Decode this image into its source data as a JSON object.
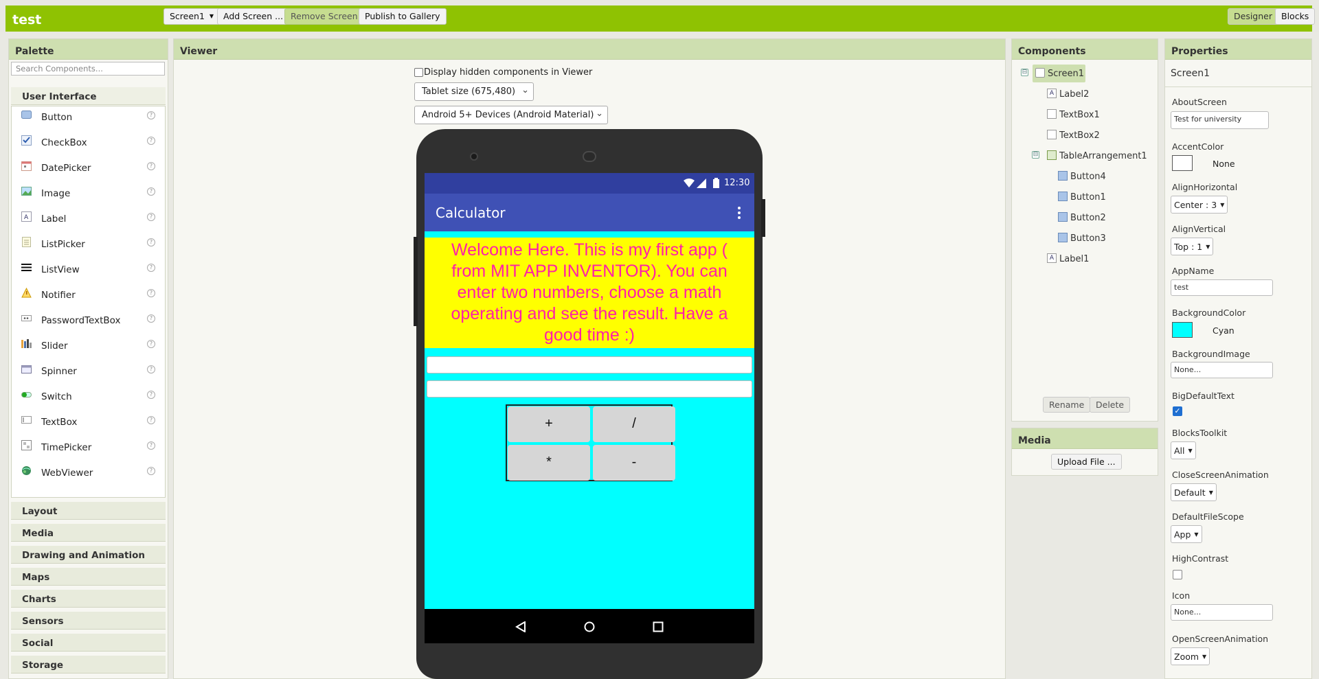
{
  "app": {
    "title": "test"
  },
  "toolbar": {
    "screen_select": "Screen1",
    "add_screen": "Add Screen ...",
    "remove_screen": "Remove Screen",
    "publish": "Publish to Gallery",
    "designer": "Designer",
    "blocks": "Blocks"
  },
  "palette": {
    "title": "Palette",
    "search_placeholder": "Search Components...",
    "open_category": "User Interface",
    "items": [
      {
        "label": "Button",
        "icon": "button-icon"
      },
      {
        "label": "CheckBox",
        "icon": "checkbox-icon"
      },
      {
        "label": "DatePicker",
        "icon": "datepicker-icon"
      },
      {
        "label": "Image",
        "icon": "image-icon"
      },
      {
        "label": "Label",
        "icon": "label-icon"
      },
      {
        "label": "ListPicker",
        "icon": "listpicker-icon"
      },
      {
        "label": "ListView",
        "icon": "listview-icon"
      },
      {
        "label": "Notifier",
        "icon": "notifier-icon"
      },
      {
        "label": "PasswordTextBox",
        "icon": "password-icon"
      },
      {
        "label": "Slider",
        "icon": "slider-icon"
      },
      {
        "label": "Spinner",
        "icon": "spinner-icon"
      },
      {
        "label": "Switch",
        "icon": "switch-icon"
      },
      {
        "label": "TextBox",
        "icon": "textbox-icon"
      },
      {
        "label": "TimePicker",
        "icon": "timepicker-icon"
      },
      {
        "label": "WebViewer",
        "icon": "webviewer-icon"
      }
    ],
    "help_glyph": "?",
    "categories": [
      "Layout",
      "Media",
      "Drawing and Animation",
      "Maps",
      "Charts",
      "Sensors",
      "Social",
      "Storage"
    ]
  },
  "viewer": {
    "title": "Viewer",
    "hidden_label": "Display hidden components in Viewer",
    "size_select": "Tablet size (675,480)",
    "theme_select": "Android 5+ Devices (Android Material)",
    "phone": {
      "time": "12:30",
      "app_title": "Calculator",
      "welcome": "Welcome Here. This is my first app ( from MIT APP INVENTOR). You can enter two numbers, choose a math operating and see the result. Have a good time :)",
      "buttons": [
        "+",
        "/",
        "*",
        "-"
      ]
    }
  },
  "components": {
    "title": "Components",
    "tree": [
      {
        "label": "Screen1",
        "icon": "screen-icon"
      },
      {
        "label": "Label2",
        "icon": "label-icon"
      },
      {
        "label": "TextBox1",
        "icon": "textbox-icon"
      },
      {
        "label": "TextBox2",
        "icon": "textbox-icon"
      },
      {
        "label": "TableArrangement1",
        "icon": "table-icon"
      },
      {
        "label": "Button4",
        "icon": "button-icon"
      },
      {
        "label": "Button1",
        "icon": "button-icon"
      },
      {
        "label": "Button2",
        "icon": "button-icon"
      },
      {
        "label": "Button3",
        "icon": "button-icon"
      },
      {
        "label": "Label1",
        "icon": "label-icon"
      }
    ],
    "toggle_glyph": "⊟",
    "rename": "Rename",
    "delete": "Delete"
  },
  "media": {
    "title": "Media",
    "upload": "Upload File ..."
  },
  "properties": {
    "title": "Properties",
    "component": "Screen1",
    "about_label": "AboutScreen",
    "about_value": "Test for university",
    "accent_label": "AccentColor",
    "accent_value": "None",
    "alignh_label": "AlignHorizontal",
    "alignh_value": "Center : 3",
    "alignv_label": "AlignVertical",
    "alignv_value": "Top : 1",
    "appname_label": "AppName",
    "appname_value": "test",
    "bgcolor_label": "BackgroundColor",
    "bgcolor_value": "Cyan",
    "bgimage_label": "BackgroundImage",
    "bgimage_value": "None...",
    "bigtext_label": "BigDefaultText",
    "bigtext_checked": true,
    "toolkit_label": "BlocksToolkit",
    "toolkit_value": "All",
    "closeanim_label": "CloseScreenAnimation",
    "closeanim_value": "Default",
    "filescope_label": "DefaultFileScope",
    "filescope_value": "App",
    "contrast_label": "HighContrast",
    "contrast_checked": false,
    "icon_label": "Icon",
    "icon_value": "None...",
    "openanim_label": "OpenScreenAnimation",
    "openanim_value": "Zoom"
  },
  "colors": {
    "brand": "#8fc202",
    "phone_bg": "#00ffff",
    "welcome_bg": "#ffff00",
    "welcome_text": "#ff1fa8",
    "appbar": "#3f51b5",
    "statusbar": "#303f9f"
  }
}
